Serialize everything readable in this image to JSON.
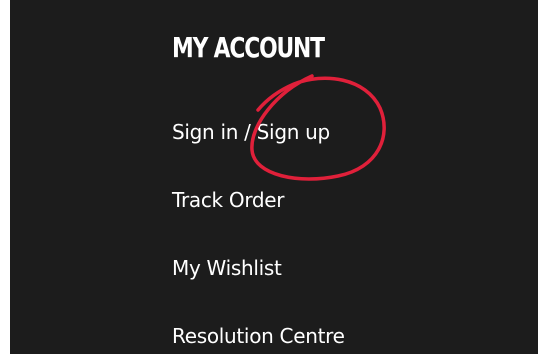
{
  "account_menu": {
    "title": "MY ACCOUNT",
    "items": [
      {
        "label": "Sign in / Sign up"
      },
      {
        "label": "Track Order"
      },
      {
        "label": "My Wishlist"
      },
      {
        "label": "Resolution Centre"
      }
    ]
  },
  "colors": {
    "panel_background": "#1c1c1c",
    "text": "#ffffff",
    "annotation": "#e0203a"
  }
}
